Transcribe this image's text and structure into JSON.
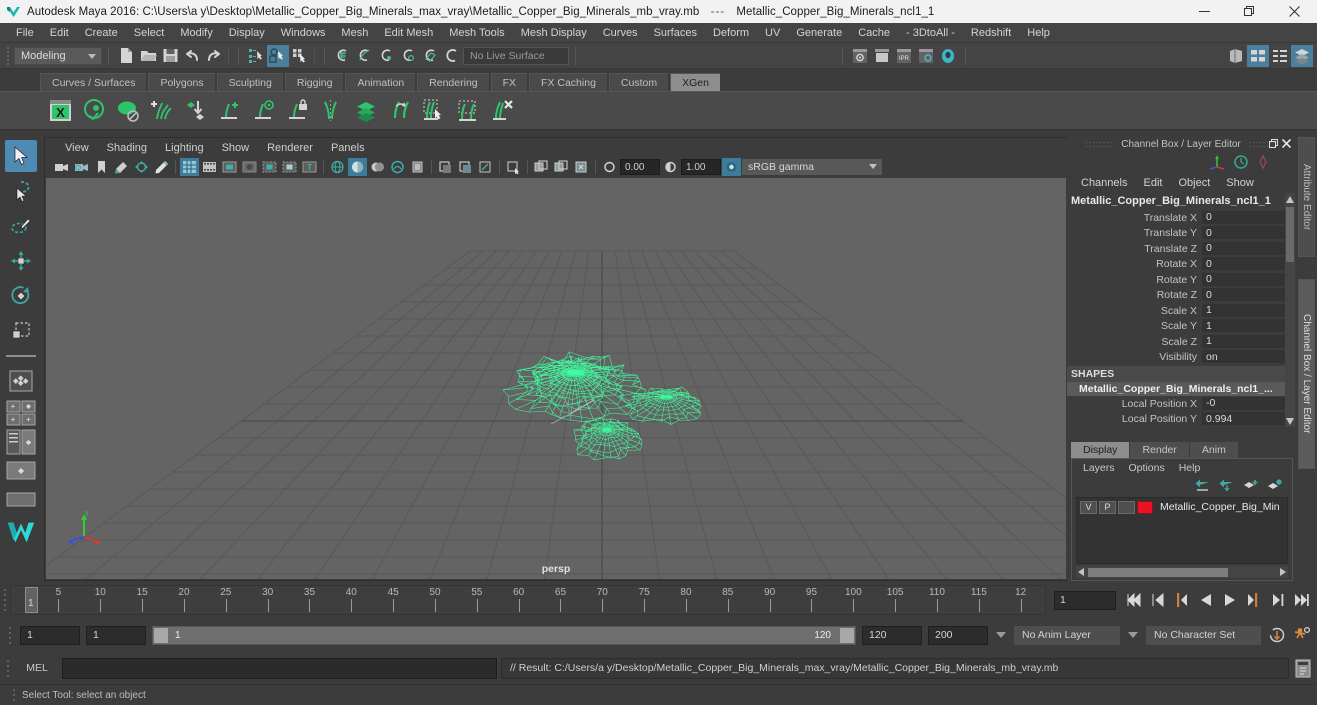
{
  "window": {
    "app_title": "Autodesk Maya 2016:",
    "file_path": "C:\\Users\\a y\\Desktop\\Metallic_Copper_Big_Minerals_max_vray\\Metallic_Copper_Big_Minerals_mb_vray.mb",
    "separator": "---",
    "selected_node": "Metallic_Copper_Big_Minerals_ncl1_1",
    "minimize_label": "Minimize",
    "restore_label": "Restore",
    "close_label": "Close"
  },
  "menu_bar": {
    "items": [
      "File",
      "Edit",
      "Create",
      "Select",
      "Modify",
      "Display",
      "Windows",
      "Mesh",
      "Edit Mesh",
      "Mesh Tools",
      "Mesh Display",
      "Curves",
      "Surfaces",
      "Deform",
      "UV",
      "Generate",
      "Cache",
      "- 3DtoAll -",
      "Redshift",
      "Help"
    ]
  },
  "status_line": {
    "menu_set": "Modeling",
    "live_surface": "No Live Surface",
    "icons": [
      "new-scene-icon",
      "open-scene-icon",
      "save-scene-icon",
      "undo-icon",
      "redo-icon",
      "select-by-hierarchy-icon",
      "select-by-object-icon",
      "select-by-component-icon",
      "snap-to-grid-icon",
      "snap-to-curve-icon",
      "snap-to-point-icon",
      "snap-to-projected-center-icon",
      "snap-to-view-plane-icon",
      "make-live-icon",
      "render-current-frame-icon",
      "render-sequence-icon",
      "ipr-render-icon",
      "render-settings-icon",
      "hypershade-icon",
      "show-hide-attribute-editor-icon",
      "show-hide-tool-settings-icon",
      "show-hide-channel-box-icon",
      "layer-editor-icon"
    ]
  },
  "shelf": {
    "tabs": [
      "Curves / Surfaces",
      "Polygons",
      "Sculpting",
      "Rigging",
      "Animation",
      "Rendering",
      "FX",
      "FX Caching",
      "Custom",
      "XGen"
    ],
    "active_tab": "XGen",
    "buttons": [
      "xgen-editor-icon",
      "xgen-preview-icon",
      "xgen-geometry-icon",
      "xgen-add-description-icon",
      "xgen-import-icon",
      "xgen-add-guide-icon",
      "xgen-preview-guide-icon",
      "xgen-lock-guide-icon",
      "xgen-mirror-guide-icon",
      "xgen-layer-icon",
      "xgen-move-guide-icon",
      "xgen-select-guide-icon",
      "xgen-region-icon",
      "xgen-delete-guide-icon"
    ]
  },
  "toolbox": {
    "tools": [
      {
        "name": "select-tool",
        "active": true
      },
      {
        "name": "lasso-select-tool",
        "active": false
      },
      {
        "name": "paint-select-tool",
        "active": false
      },
      {
        "name": "move-tool",
        "active": false
      },
      {
        "name": "rotate-tool",
        "active": false
      },
      {
        "name": "scale-tool",
        "active": false
      },
      {
        "name": "last-tool-used",
        "active": false
      },
      {
        "name": "four-view-layout",
        "active": false
      },
      {
        "name": "persp-outliner-layout",
        "active": false
      },
      {
        "name": "persp-graph-layout",
        "active": false
      },
      {
        "name": "single-perspective-layout",
        "active": false
      },
      {
        "name": "maya-logo-icon",
        "active": false
      }
    ]
  },
  "viewport": {
    "menus": [
      "View",
      "Shading",
      "Lighting",
      "Show",
      "Renderer",
      "Panels"
    ],
    "camera_label": "persp",
    "exposure_value": "0.00",
    "gamma_value": "1.00",
    "color_management": "sRGB gamma",
    "toolbar_icons": [
      "select-camera-icon",
      "camera-attributes-icon",
      "bookmark-icon",
      "image-plane-icon",
      "two-d-pan-zoom-icon",
      "grease-pencil-icon",
      "grid-toggle-icon",
      "film-gate-icon",
      "resolution-gate-icon",
      "gate-mask-icon",
      "film-origin-icon",
      "safe-action-icon",
      "title-safe-icon",
      "wireframe-icon",
      "smooth-shade-all-icon",
      "shaded-wireframe-icon",
      "textured-icon",
      "lights-icon",
      "shadows-icon",
      "screen-space-ao-icon",
      "motion-blur-icon",
      "multisample-icon",
      "depth-of-field-icon",
      "xray-icon",
      "xray-joints-icon",
      "xray-active-components-icon",
      "exposure-icon",
      "gamma-icon",
      "color-management-icon"
    ]
  },
  "channel_box": {
    "panel_title": "Channel Box / Layer Editor",
    "menus": [
      "Channels",
      "Edit",
      "Object",
      "Show"
    ],
    "node_name": "Metallic_Copper_Big_Minerals_ncl1_1",
    "transform_attributes": [
      {
        "label": "Translate X",
        "value": "0"
      },
      {
        "label": "Translate Y",
        "value": "0"
      },
      {
        "label": "Translate Z",
        "value": "0"
      },
      {
        "label": "Rotate X",
        "value": "0"
      },
      {
        "label": "Rotate Y",
        "value": "0"
      },
      {
        "label": "Rotate Z",
        "value": "0"
      },
      {
        "label": "Scale X",
        "value": "1"
      },
      {
        "label": "Scale Y",
        "value": "1"
      },
      {
        "label": "Scale Z",
        "value": "1"
      },
      {
        "label": "Visibility",
        "value": "on"
      }
    ],
    "shapes_header": "SHAPES",
    "shape_name": "Metallic_Copper_Big_Minerals_ncl1_...",
    "shape_attributes": [
      {
        "label": "Local Position X",
        "value": "-0"
      },
      {
        "label": "Local Position Y",
        "value": "0.994"
      }
    ]
  },
  "layer_editor": {
    "tabs": [
      "Display",
      "Render",
      "Anim"
    ],
    "active_tab": "Display",
    "menus": [
      "Layers",
      "Options",
      "Help"
    ],
    "toolbar_icons": [
      "move-layer-up-icon",
      "move-layer-down-icon",
      "new-layer-icon",
      "new-layer-from-selected-icon"
    ],
    "layers": [
      {
        "visibility": "V",
        "playback": "P",
        "state": "",
        "color": "#ee1122",
        "name": "Metallic_Copper_Big_Min"
      }
    ]
  },
  "side_tabs": {
    "items": [
      "Attribute Editor",
      "Channel Box / Layer Editor"
    ]
  },
  "time_slider": {
    "current_frame": "1",
    "start_tick": 1,
    "end_tick": 120,
    "tick_step": 5,
    "labels": [
      "5",
      "10",
      "15",
      "20",
      "25",
      "30",
      "35",
      "40",
      "45",
      "50",
      "55",
      "60",
      "65",
      "70",
      "75",
      "80",
      "85",
      "90",
      "95",
      "100",
      "105",
      "110",
      "115",
      "12"
    ],
    "frame_field": "1",
    "playback_buttons": [
      "go-to-start-icon",
      "step-back-keyframe-icon",
      "step-back-frame-icon",
      "play-backwards-icon",
      "play-forwards-icon",
      "step-forward-frame-icon",
      "step-forward-keyframe-icon",
      "go-to-end-icon"
    ]
  },
  "range_slider": {
    "anim_start": "1",
    "playback_start": "1",
    "range_min_label": "1",
    "range_max_label": "120",
    "playback_end": "120",
    "anim_end": "200",
    "anim_layer": "No Anim Layer",
    "character_set": "No Character Set",
    "auto_key_icon": "auto-keyframe-icon",
    "anim_prefs_icon": "animation-preferences-icon"
  },
  "command_line": {
    "label": "MEL",
    "input_value": "",
    "result_text": "// Result: C:/Users/a y/Desktop/Metallic_Copper_Big_Minerals_max_vray/Metallic_Copper_Big_Minerals_mb_vray.mb",
    "script_editor_icon": "script-editor-icon"
  },
  "help_line": {
    "text": "Select Tool: select an object"
  },
  "colors": {
    "accent_blue": "#4f8ab5",
    "wireframe_green": "#3dffa0",
    "panel_bg": "#3c3c3c",
    "viewport_bg": "#646464",
    "titlebar_bg": "#f2f2f2"
  }
}
